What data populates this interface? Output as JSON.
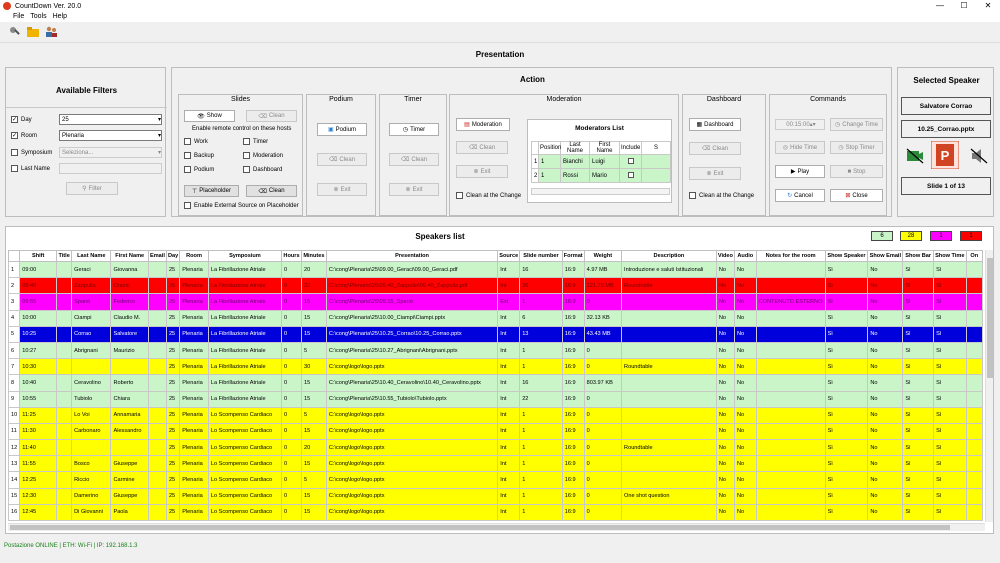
{
  "app": {
    "title": "CountDown Ver. 20.0",
    "minimize": "—",
    "maximize": "☐",
    "close": "✕"
  },
  "menu": [
    "File",
    "Tools",
    "Help"
  ],
  "presentation_title": "Presentation",
  "filters": {
    "title": "Available Filters",
    "day": {
      "label": "Day",
      "value": "25",
      "checked": "✓"
    },
    "room": {
      "label": "Room",
      "value": "Plenaria",
      "checked": "✓"
    },
    "symposium": {
      "label": "Symposium",
      "placeholder": "Seleziona..."
    },
    "last_name": {
      "label": "Last Name"
    },
    "filter_button": "Filter"
  },
  "action": {
    "title": "Action",
    "slides": {
      "title": "Slides",
      "show": "Show",
      "clean": "Clean",
      "remote_text": "Enable remote control on these hosts",
      "hosts": [
        "Work",
        "Timer",
        "Backup",
        "Moderation",
        "Podium",
        "Dashboard"
      ],
      "placeholder": "Placeholder",
      "clean2": "Clean",
      "external": "Enable External Source on Placeholder"
    },
    "podium": {
      "title": "Podium",
      "button": "Podium",
      "clean": "Clean",
      "exit": "Exit"
    },
    "timer": {
      "title": "Timer",
      "button": "Timer",
      "clean": "Clean",
      "exit": "Exit"
    },
    "moderation": {
      "title": "Moderation",
      "button": "Moderation",
      "clean": "Clean",
      "exit": "Exit",
      "clean_change": "Clean at the Change",
      "list_title": "Moderators List",
      "columns": [
        "",
        "Position",
        "Last Name",
        "First Name",
        "Include",
        "S"
      ],
      "rows": [
        [
          "1",
          "1",
          "Bianchi",
          "Luigi",
          ""
        ],
        [
          "2",
          "1",
          "Rossi",
          "Mario",
          ""
        ]
      ]
    },
    "dashboard": {
      "title": "Dashboard",
      "button": "Dashboard",
      "clean": "Clean",
      "exit": "Exit",
      "clean_change": "Clean at the Change"
    },
    "commands": {
      "title": "Commands",
      "time": "00:15:00",
      "change_time": "Change Time",
      "hide_time": "Hide Time",
      "stop_timer": "Stop Timer",
      "play": "Play",
      "stop": "Stop",
      "cancel": "Cancel",
      "close": "Close"
    }
  },
  "selected_speaker": {
    "title": "Selected Speaker",
    "name": "Salvatore Corrao",
    "file": "10.25_Corrao.pptx",
    "slide": "Slide 1 of 13"
  },
  "speakers": {
    "title": "Speakers list",
    "badges": [
      {
        "text": "6",
        "color": "#c9f5c9"
      },
      {
        "text": "28",
        "color": "#ffff00"
      },
      {
        "text": "1",
        "color": "#ff00ff"
      },
      {
        "text": "1",
        "color": "#ff0000"
      }
    ],
    "columns": [
      "",
      "Shift",
      "Title",
      "Last Name",
      "First Name",
      "Email",
      "Day",
      "Room",
      "Symposium",
      "Hours",
      "Minutes",
      "Presentation",
      "Source",
      "Slide number",
      "Format",
      "Weight",
      "Description",
      "Video",
      "Audio",
      "Notes for the room",
      "Show Speaker",
      "Show Email",
      "Show Bar",
      "Show Time",
      "On"
    ],
    "rows": [
      {
        "bg": "#c9f5c9",
        "fg": "#000000",
        "cells": [
          "1",
          "09:00",
          "",
          "Geraci",
          "Giovanna",
          "",
          "25",
          "Plenaria",
          "La Fibrillazione Atriale",
          "0",
          "20",
          "C:\\cong\\Plenaria\\25\\09.00_Geraci\\09.00_Geraci.pdf",
          "Int",
          "16",
          "16:9",
          "4.97 MB",
          "Introduzione e saluti Istituzionali",
          "No",
          "No",
          "",
          "Sì",
          "No",
          "Sì",
          "Sì",
          ""
        ]
      },
      {
        "bg": "#ff0000",
        "fg": "#7a0000",
        "cells": [
          "2",
          "09:40",
          "",
          "Zappulla",
          "Orazio",
          "",
          "25",
          "Plenaria",
          "La Fibrillazione Atriale",
          "0",
          "30",
          "C:\\cong\\Plenaria\\25\\09.40_Zappulla\\09.40_Zappulla.pdf",
          "Int",
          "36",
          "16:9",
          "121.70 MB",
          "Roundtable",
          "No",
          "No",
          "",
          "Sì",
          "No",
          "Sì",
          "Sì",
          ""
        ]
      },
      {
        "bg": "#ff00ff",
        "fg": "#6a006a",
        "cells": [
          "3",
          "09:55",
          "",
          "Spanò",
          "Federico",
          "",
          "25",
          "Plenaria",
          "La Fibrillazione Atriale",
          "0",
          "15",
          "C:\\cong\\Plenaria\\25\\09.55_Spanò",
          "Ext",
          "1",
          "16:9",
          "0",
          "",
          "No",
          "No",
          "CONTENUTO ESTERNO",
          "Sì",
          "No",
          "Sì",
          "Sì",
          ""
        ]
      },
      {
        "bg": "#c9f5c9",
        "fg": "#000000",
        "cells": [
          "4",
          "10:00",
          "",
          "Ciampi",
          "Claudio M.",
          "",
          "25",
          "Plenaria",
          "La Fibrillazione Atriale",
          "0",
          "15",
          "C:\\cong\\Plenaria\\25\\10.00_Ciampi\\Ciampi.pptx",
          "Int",
          "6",
          "16:9",
          "32.13 KB",
          "",
          "No",
          "No",
          "",
          "Sì",
          "No",
          "Sì",
          "Sì",
          ""
        ]
      },
      {
        "bg": "#0000dd",
        "fg": "#ffffff",
        "cells": [
          "5",
          "10:25",
          "",
          "Corrao",
          "Salvatore",
          "",
          "25",
          "Plenaria",
          "La Fibrillazione Atriale",
          "0",
          "15",
          "C:\\cong\\Plenaria\\25\\10.25_Corrao\\10.25_Corrao.pptx",
          "Int",
          "13",
          "16:9",
          "43.43 MB",
          "",
          "No",
          "No",
          "",
          "Sì",
          "No",
          "Sì",
          "Sì",
          ""
        ]
      },
      {
        "bg": "#c9f5c9",
        "fg": "#000000",
        "cells": [
          "6",
          "10:27",
          "",
          "Abrignani",
          "Maurizio",
          "",
          "25",
          "Plenaria",
          "La Fibrillazione Atriale",
          "0",
          "5",
          "C:\\cong\\Plenaria\\25\\10.27_Abrignani\\Abrignani.pptx",
          "Int",
          "1",
          "16:9",
          "0",
          "",
          "No",
          "No",
          "",
          "Sì",
          "No",
          "Sì",
          "Sì",
          ""
        ]
      },
      {
        "bg": "#ffff00",
        "fg": "#000000",
        "cells": [
          "7",
          "10:30",
          "",
          "",
          "",
          "",
          "25",
          "Plenaria",
          "La Fibrillazione Atriale",
          "0",
          "30",
          "C:\\cong\\logo\\logo.pptx",
          "Int",
          "1",
          "16:9",
          "0",
          "Roundtable",
          "No",
          "No",
          "",
          "Sì",
          "No",
          "Sì",
          "Sì",
          ""
        ]
      },
      {
        "bg": "#c9f5c9",
        "fg": "#000000",
        "cells": [
          "8",
          "10:40",
          "",
          "Ceravolino",
          "Roberto",
          "",
          "25",
          "Plenaria",
          "La Fibrillazione Atriale",
          "0",
          "15",
          "C:\\cong\\Plenaria\\25\\10.40_Ceravolino\\10.40_Ceravolino.pptx",
          "Int",
          "16",
          "16:9",
          "803.97 KB",
          "",
          "No",
          "No",
          "",
          "Sì",
          "No",
          "Sì",
          "Sì",
          ""
        ]
      },
      {
        "bg": "#c9f5c9",
        "fg": "#000000",
        "cells": [
          "9",
          "10:55",
          "",
          "Tubiolo",
          "Chiara",
          "",
          "25",
          "Plenaria",
          "La Fibrillazione Atriale",
          "0",
          "15",
          "C:\\cong\\Plenaria\\25\\10.55_Tubiolo\\Tubiolo.pptx",
          "Int",
          "22",
          "16:9",
          "0",
          "",
          "No",
          "No",
          "",
          "Sì",
          "No",
          "Sì",
          "Sì",
          ""
        ]
      },
      {
        "bg": "#ffff00",
        "fg": "#000000",
        "cells": [
          "10",
          "11:25",
          "",
          "Lo Voi",
          "Annamaria",
          "",
          "25",
          "Plenaria",
          "Lo Scompenso Cardiaco",
          "0",
          "5",
          "C:\\cong\\logo\\logo.pptx",
          "Int",
          "1",
          "16:9",
          "0",
          "",
          "No",
          "No",
          "",
          "Sì",
          "No",
          "Sì",
          "Sì",
          ""
        ]
      },
      {
        "bg": "#ffff00",
        "fg": "#000000",
        "cells": [
          "11",
          "11:30",
          "",
          "Carbonaro",
          "Alessandro",
          "",
          "25",
          "Plenaria",
          "Lo Scompenso Cardiaco",
          "0",
          "15",
          "C:\\cong\\logo\\logo.pptx",
          "Int",
          "1",
          "16:9",
          "0",
          "",
          "No",
          "No",
          "",
          "Sì",
          "No",
          "Sì",
          "Sì",
          ""
        ]
      },
      {
        "bg": "#ffff00",
        "fg": "#000000",
        "cells": [
          "12",
          "11:40",
          "",
          "",
          "",
          "",
          "25",
          "Plenaria",
          "Lo Scompenso Cardiaco",
          "0",
          "20",
          "C:\\cong\\logo\\logo.pptx",
          "Int",
          "1",
          "16:9",
          "0",
          "Roundtable",
          "No",
          "No",
          "",
          "Sì",
          "No",
          "Sì",
          "Sì",
          ""
        ]
      },
      {
        "bg": "#ffff00",
        "fg": "#000000",
        "cells": [
          "13",
          "11:55",
          "",
          "Bosco",
          "Giuseppe",
          "",
          "25",
          "Plenaria",
          "Lo Scompenso Cardiaco",
          "0",
          "15",
          "C:\\cong\\logo\\logo.pptx",
          "Int",
          "1",
          "16:9",
          "0",
          "",
          "No",
          "No",
          "",
          "Sì",
          "No",
          "Sì",
          "Sì",
          ""
        ]
      },
      {
        "bg": "#ffff00",
        "fg": "#000000",
        "cells": [
          "14",
          "12:25",
          "",
          "Riccio",
          "Carmine",
          "",
          "25",
          "Plenaria",
          "Lo Scompenso Cardiaco",
          "0",
          "5",
          "C:\\cong\\logo\\logo.pptx",
          "Int",
          "1",
          "16:9",
          "0",
          "",
          "No",
          "No",
          "",
          "Sì",
          "No",
          "Sì",
          "Sì",
          ""
        ]
      },
      {
        "bg": "#ffff00",
        "fg": "#000000",
        "cells": [
          "15",
          "12:30",
          "",
          "Damerino",
          "Giuseppe",
          "",
          "25",
          "Plenaria",
          "Lo Scompenso Cardiaco",
          "0",
          "15",
          "C:\\cong\\logo\\logo.pptx",
          "Int",
          "1",
          "16:9",
          "0",
          "One shot question",
          "No",
          "No",
          "",
          "Sì",
          "No",
          "Sì",
          "Sì",
          ""
        ]
      },
      {
        "bg": "#ffff00",
        "fg": "#000000",
        "cells": [
          "16",
          "12:45",
          "",
          "Di Giovanni",
          "Paola",
          "",
          "25",
          "Plenaria",
          "Lo Scompenso Cardiaco",
          "0",
          "15",
          "C:\\cong\\logo\\logo.pptx",
          "Int",
          "1",
          "16:9",
          "0",
          "",
          "No",
          "No",
          "",
          "Sì",
          "No",
          "Sì",
          "Sì",
          ""
        ]
      }
    ]
  },
  "status_bar": "Postazione ONLINE | ETH: Wi-Fi | IP: 192.168.1.3"
}
